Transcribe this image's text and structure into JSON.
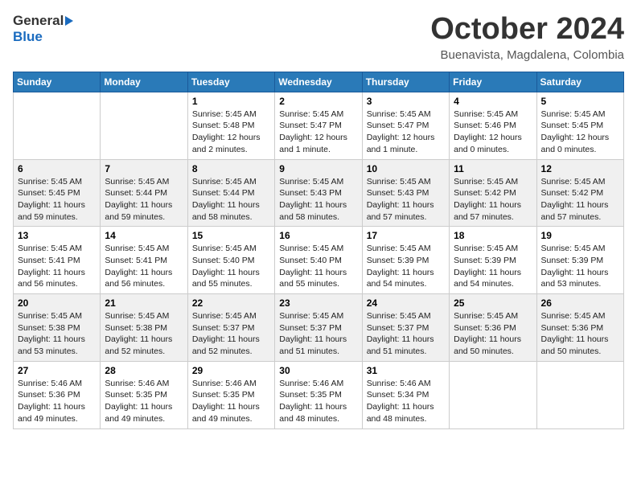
{
  "header": {
    "logo_general": "General",
    "logo_blue": "Blue",
    "month": "October 2024",
    "location": "Buenavista, Magdalena, Colombia"
  },
  "weekdays": [
    "Sunday",
    "Monday",
    "Tuesday",
    "Wednesday",
    "Thursday",
    "Friday",
    "Saturday"
  ],
  "weeks": [
    [
      {
        "day": "",
        "sunrise": "",
        "sunset": "",
        "daylight": ""
      },
      {
        "day": "",
        "sunrise": "",
        "sunset": "",
        "daylight": ""
      },
      {
        "day": "1",
        "sunrise": "Sunrise: 5:45 AM",
        "sunset": "Sunset: 5:48 PM",
        "daylight": "Daylight: 12 hours and 2 minutes."
      },
      {
        "day": "2",
        "sunrise": "Sunrise: 5:45 AM",
        "sunset": "Sunset: 5:47 PM",
        "daylight": "Daylight: 12 hours and 1 minute."
      },
      {
        "day": "3",
        "sunrise": "Sunrise: 5:45 AM",
        "sunset": "Sunset: 5:47 PM",
        "daylight": "Daylight: 12 hours and 1 minute."
      },
      {
        "day": "4",
        "sunrise": "Sunrise: 5:45 AM",
        "sunset": "Sunset: 5:46 PM",
        "daylight": "Daylight: 12 hours and 0 minutes."
      },
      {
        "day": "5",
        "sunrise": "Sunrise: 5:45 AM",
        "sunset": "Sunset: 5:45 PM",
        "daylight": "Daylight: 12 hours and 0 minutes."
      }
    ],
    [
      {
        "day": "6",
        "sunrise": "Sunrise: 5:45 AM",
        "sunset": "Sunset: 5:45 PM",
        "daylight": "Daylight: 11 hours and 59 minutes."
      },
      {
        "day": "7",
        "sunrise": "Sunrise: 5:45 AM",
        "sunset": "Sunset: 5:44 PM",
        "daylight": "Daylight: 11 hours and 59 minutes."
      },
      {
        "day": "8",
        "sunrise": "Sunrise: 5:45 AM",
        "sunset": "Sunset: 5:44 PM",
        "daylight": "Daylight: 11 hours and 58 minutes."
      },
      {
        "day": "9",
        "sunrise": "Sunrise: 5:45 AM",
        "sunset": "Sunset: 5:43 PM",
        "daylight": "Daylight: 11 hours and 58 minutes."
      },
      {
        "day": "10",
        "sunrise": "Sunrise: 5:45 AM",
        "sunset": "Sunset: 5:43 PM",
        "daylight": "Daylight: 11 hours and 57 minutes."
      },
      {
        "day": "11",
        "sunrise": "Sunrise: 5:45 AM",
        "sunset": "Sunset: 5:42 PM",
        "daylight": "Daylight: 11 hours and 57 minutes."
      },
      {
        "day": "12",
        "sunrise": "Sunrise: 5:45 AM",
        "sunset": "Sunset: 5:42 PM",
        "daylight": "Daylight: 11 hours and 57 minutes."
      }
    ],
    [
      {
        "day": "13",
        "sunrise": "Sunrise: 5:45 AM",
        "sunset": "Sunset: 5:41 PM",
        "daylight": "Daylight: 11 hours and 56 minutes."
      },
      {
        "day": "14",
        "sunrise": "Sunrise: 5:45 AM",
        "sunset": "Sunset: 5:41 PM",
        "daylight": "Daylight: 11 hours and 56 minutes."
      },
      {
        "day": "15",
        "sunrise": "Sunrise: 5:45 AM",
        "sunset": "Sunset: 5:40 PM",
        "daylight": "Daylight: 11 hours and 55 minutes."
      },
      {
        "day": "16",
        "sunrise": "Sunrise: 5:45 AM",
        "sunset": "Sunset: 5:40 PM",
        "daylight": "Daylight: 11 hours and 55 minutes."
      },
      {
        "day": "17",
        "sunrise": "Sunrise: 5:45 AM",
        "sunset": "Sunset: 5:39 PM",
        "daylight": "Daylight: 11 hours and 54 minutes."
      },
      {
        "day": "18",
        "sunrise": "Sunrise: 5:45 AM",
        "sunset": "Sunset: 5:39 PM",
        "daylight": "Daylight: 11 hours and 54 minutes."
      },
      {
        "day": "19",
        "sunrise": "Sunrise: 5:45 AM",
        "sunset": "Sunset: 5:39 PM",
        "daylight": "Daylight: 11 hours and 53 minutes."
      }
    ],
    [
      {
        "day": "20",
        "sunrise": "Sunrise: 5:45 AM",
        "sunset": "Sunset: 5:38 PM",
        "daylight": "Daylight: 11 hours and 53 minutes."
      },
      {
        "day": "21",
        "sunrise": "Sunrise: 5:45 AM",
        "sunset": "Sunset: 5:38 PM",
        "daylight": "Daylight: 11 hours and 52 minutes."
      },
      {
        "day": "22",
        "sunrise": "Sunrise: 5:45 AM",
        "sunset": "Sunset: 5:37 PM",
        "daylight": "Daylight: 11 hours and 52 minutes."
      },
      {
        "day": "23",
        "sunrise": "Sunrise: 5:45 AM",
        "sunset": "Sunset: 5:37 PM",
        "daylight": "Daylight: 11 hours and 51 minutes."
      },
      {
        "day": "24",
        "sunrise": "Sunrise: 5:45 AM",
        "sunset": "Sunset: 5:37 PM",
        "daylight": "Daylight: 11 hours and 51 minutes."
      },
      {
        "day": "25",
        "sunrise": "Sunrise: 5:45 AM",
        "sunset": "Sunset: 5:36 PM",
        "daylight": "Daylight: 11 hours and 50 minutes."
      },
      {
        "day": "26",
        "sunrise": "Sunrise: 5:45 AM",
        "sunset": "Sunset: 5:36 PM",
        "daylight": "Daylight: 11 hours and 50 minutes."
      }
    ],
    [
      {
        "day": "27",
        "sunrise": "Sunrise: 5:46 AM",
        "sunset": "Sunset: 5:36 PM",
        "daylight": "Daylight: 11 hours and 49 minutes."
      },
      {
        "day": "28",
        "sunrise": "Sunrise: 5:46 AM",
        "sunset": "Sunset: 5:35 PM",
        "daylight": "Daylight: 11 hours and 49 minutes."
      },
      {
        "day": "29",
        "sunrise": "Sunrise: 5:46 AM",
        "sunset": "Sunset: 5:35 PM",
        "daylight": "Daylight: 11 hours and 49 minutes."
      },
      {
        "day": "30",
        "sunrise": "Sunrise: 5:46 AM",
        "sunset": "Sunset: 5:35 PM",
        "daylight": "Daylight: 11 hours and 48 minutes."
      },
      {
        "day": "31",
        "sunrise": "Sunrise: 5:46 AM",
        "sunset": "Sunset: 5:34 PM",
        "daylight": "Daylight: 11 hours and 48 minutes."
      },
      {
        "day": "",
        "sunrise": "",
        "sunset": "",
        "daylight": ""
      },
      {
        "day": "",
        "sunrise": "",
        "sunset": "",
        "daylight": ""
      }
    ]
  ]
}
